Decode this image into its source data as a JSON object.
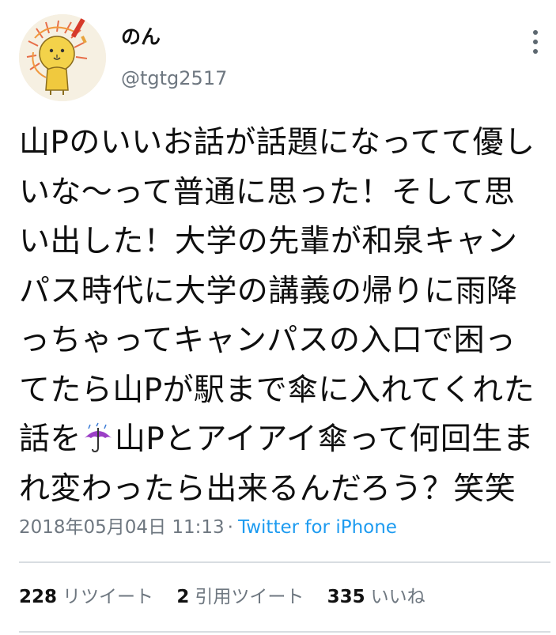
{
  "user": {
    "display_name": "のん",
    "handle": "@tgtg2517",
    "avatar_icon": "lion-drawing-avatar"
  },
  "header": {
    "more_icon": "more-vertical-icon"
  },
  "tweet": {
    "lines": [
      "山Pのいいお話が話題になってて優し",
      "いな〜って普通に思った！そして思",
      "い出した！大学の先輩が和泉キャン",
      "パス時代に大学の講義の帰りに雨降",
      "っちゃってキャンパスの入口で困っ",
      "てたら山Pが駅まで傘に入れてくれた"
    ],
    "line7_before": "話を",
    "emoji_icon": "umbrella-with-rain-icon",
    "line7_after": "山Pとアイアイ傘って何回生ま",
    "line8": "れ変わったら出来るんだろう？笑笑"
  },
  "meta": {
    "timestamp": "2018年05月04日 11:13",
    "separator": "·",
    "source": "Twitter for iPhone"
  },
  "stats": {
    "retweets": {
      "count": "228",
      "label": "リツイート"
    },
    "quotes": {
      "count": "2",
      "label": "引用ツイート"
    },
    "likes": {
      "count": "335",
      "label": "いいね"
    }
  },
  "colors": {
    "link": "#1d9bf0",
    "muted": "#6e7780",
    "divider": "#d8dde1",
    "umbrella": "#9b3fc6"
  }
}
